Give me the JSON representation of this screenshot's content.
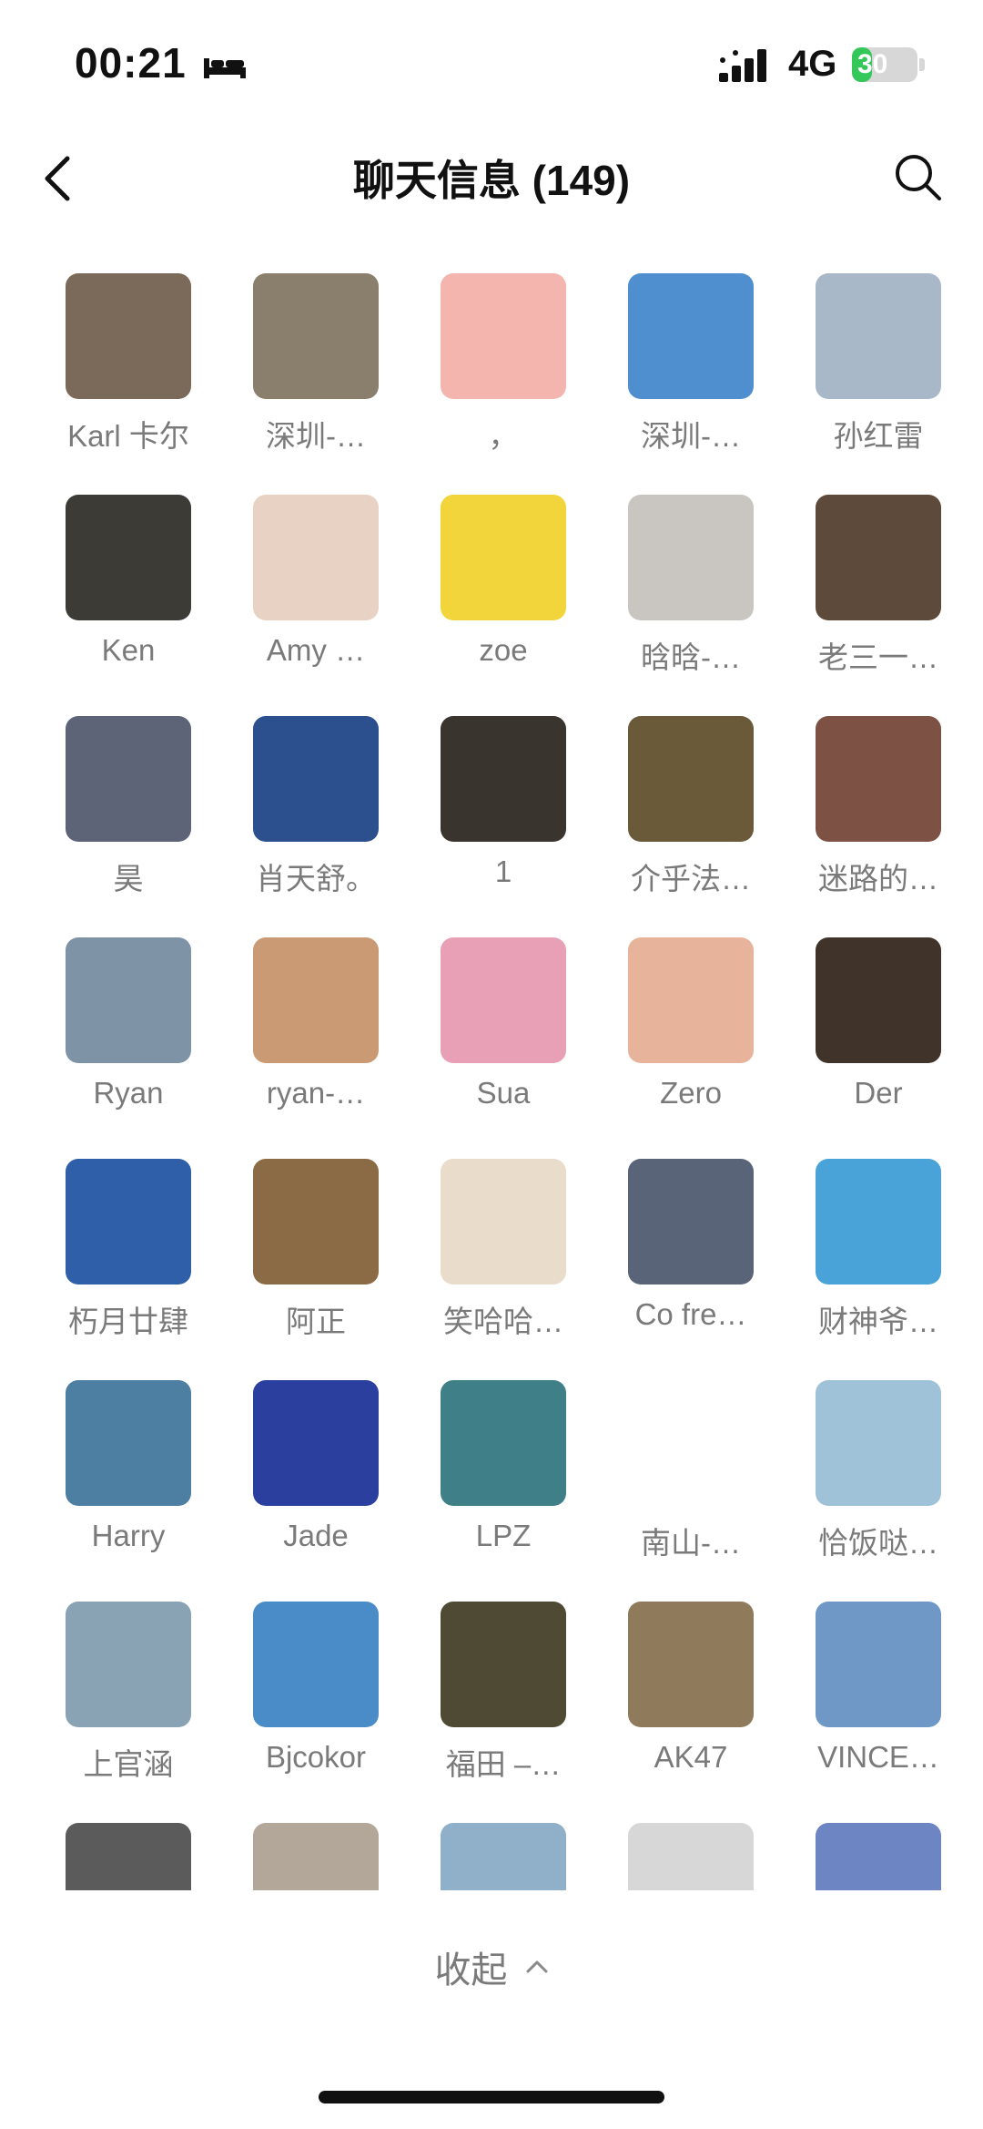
{
  "status": {
    "time": "00:21",
    "network": "4G",
    "battery": "30",
    "battery_fraction": 0.3,
    "battery_color": "#34c759",
    "bed_icon": "bed-icon",
    "signal_icon": "cellular-signal-icon"
  },
  "header": {
    "title": "聊天信息 (149)",
    "back_icon": "back-chevron-icon",
    "search_icon": "search-icon"
  },
  "members": [
    {
      "name": "Karl 卡尔",
      "color": "#7b6a5a"
    },
    {
      "name": "深圳-…",
      "color": "#8a7f6c"
    },
    {
      "name": "，",
      "color": "#f4b5ae"
    },
    {
      "name": "深圳-…",
      "color": "#4f8fcf"
    },
    {
      "name": "孙红雷",
      "color": "#a9b8c9"
    },
    {
      "name": "Ken",
      "color": "#3d3b36"
    },
    {
      "name": "Amy …",
      "color": "#e8d2c4"
    },
    {
      "name": "zoe",
      "color": "#f2d53a"
    },
    {
      "name": "晗晗-…",
      "color": "#c9c6c1"
    },
    {
      "name": "老三一…",
      "color": "#5d4a3a"
    },
    {
      "name": "昊",
      "color": "#5e6478"
    },
    {
      "name": "肖天舒。",
      "color": "#2c4f8d"
    },
    {
      "name": "1",
      "color": "#3a342f"
    },
    {
      "name": "介乎法…",
      "color": "#6b5a3a"
    },
    {
      "name": "迷路的…",
      "color": "#7d5244"
    },
    {
      "name": "Ryan",
      "color": "#7f93a7"
    },
    {
      "name": "ryan-…",
      "color": "#c99a74"
    },
    {
      "name": "Sua",
      "color": "#e8a0b6"
    },
    {
      "name": "Zero",
      "color": "#e7b49b"
    },
    {
      "name": "Der",
      "color": "#3f332a"
    },
    {
      "name": "朽月廿肆",
      "color": "#2f5fa8"
    },
    {
      "name": "阿正",
      "color": "#8b6a46"
    },
    {
      "name": "笑哈哈…",
      "color": "#e9dccb"
    },
    {
      "name": "Co fre…",
      "color": "#5a6478"
    },
    {
      "name": "财神爷…",
      "color": "#4aa3d8"
    },
    {
      "name": "Harry",
      "color": "#4d7fa2"
    },
    {
      "name": "Jade",
      "color": "#2a3f9e"
    },
    {
      "name": "LPZ",
      "color": "#3f7f87"
    },
    {
      "name": "南山-…",
      "color": "#ffffff"
    },
    {
      "name": "恰饭哒…",
      "color": "#9fc2d8"
    },
    {
      "name": "上官涵",
      "color": "#8aa3b4"
    },
    {
      "name": "Bjcokor",
      "color": "#4a8cc7"
    },
    {
      "name": "福田 –…",
      "color": "#4f4a33"
    },
    {
      "name": "AK47",
      "color": "#8f7b5b"
    },
    {
      "name": "VINCE…",
      "color": "#6f98c7"
    },
    {
      "name": "",
      "color": "#5b5b5b"
    },
    {
      "name": "",
      "color": "#b3a79a"
    },
    {
      "name": "",
      "color": "#8fb0c8"
    },
    {
      "name": "",
      "color": "#d7d7d7"
    },
    {
      "name": "",
      "color": "#6d85c2"
    }
  ],
  "footer": {
    "collapse_label": "收起",
    "collapse_icon": "chevron-up-icon"
  }
}
